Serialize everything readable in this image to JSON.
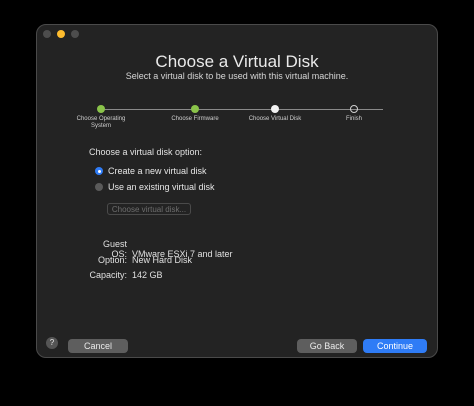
{
  "window": {
    "title": "Choose a Virtual Disk",
    "subtitle": "Select a virtual disk to be used with this virtual machine."
  },
  "steps": [
    {
      "label": "Choose Operating System",
      "state": "done"
    },
    {
      "label": "Choose Firmware",
      "state": "done"
    },
    {
      "label": "Choose Virtual Disk",
      "state": "current"
    },
    {
      "label": "Finish",
      "state": "todo"
    }
  ],
  "disk_option": {
    "label": "Choose a virtual disk option:",
    "options": [
      {
        "label": "Create a new virtual disk",
        "selected": true
      },
      {
        "label": "Use an existing virtual disk",
        "selected": false
      }
    ],
    "choose_button": "Choose virtual disk..."
  },
  "info": {
    "guest_os_key": "Guest OS:",
    "guest_os_value": "VMware ESXi 7 and later",
    "option_key": "Option:",
    "option_value": "New Hard Disk",
    "capacity_key": "Capacity:",
    "capacity_value": "142 GB"
  },
  "footer": {
    "help": "?",
    "cancel": "Cancel",
    "back": "Go Back",
    "continue": "Continue"
  },
  "colors": {
    "accent": "#2f7cf6",
    "step_done": "#8ac34a",
    "window_bg": "#232323"
  }
}
